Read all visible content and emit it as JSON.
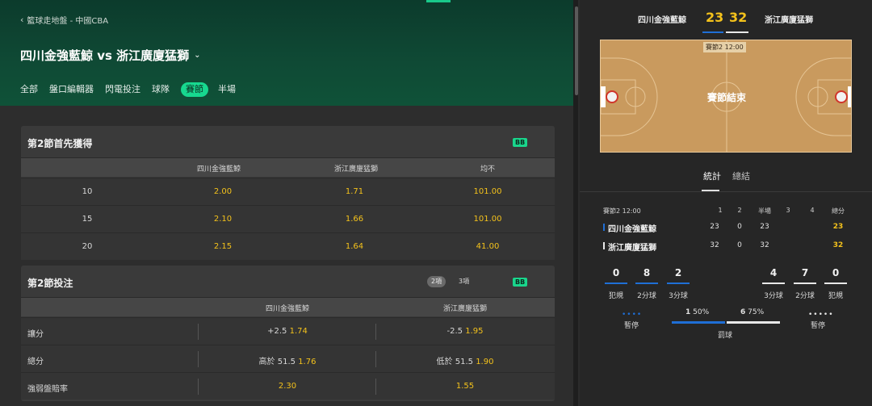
{
  "breadcrumb": "籃球走地盤 - 中國CBA",
  "match_title": "四川金強藍鯨 vs 浙江廣廈猛獅",
  "tabs": [
    {
      "label": "全部"
    },
    {
      "label": "盤口編輯器"
    },
    {
      "label": "閃電投注"
    },
    {
      "label": "球隊"
    },
    {
      "label": "賽節",
      "active": true
    },
    {
      "label": "半場"
    }
  ],
  "badge": "BB",
  "market1": {
    "title": "第2節首先獲得",
    "headers": [
      "四川金強藍鯨",
      "浙江廣廈猛獅",
      "均不"
    ],
    "rows": [
      {
        "label": "10",
        "odds": [
          "2.00",
          "1.71",
          "101.00"
        ]
      },
      {
        "label": "15",
        "odds": [
          "2.10",
          "1.66",
          "101.00"
        ]
      },
      {
        "label": "20",
        "odds": [
          "2.15",
          "1.64",
          "41.00"
        ]
      }
    ]
  },
  "market2": {
    "title": "第2節投注",
    "pill_a": "2項",
    "pill_b": "3項",
    "headers": [
      "四川金強藍鯨",
      "浙江廣廈猛獅"
    ],
    "rows": [
      {
        "label": "讓分",
        "home_line": "+2.5",
        "home_odd": "1.74",
        "away_line": "-2.5",
        "away_odd": "1.95"
      },
      {
        "label": "總分",
        "home_line": "高於 51.5",
        "home_odd": "1.76",
        "away_line": "低於 51.5",
        "away_odd": "1.90"
      },
      {
        "label": "強弱盤賠率",
        "home_line": "",
        "home_odd": "2.30",
        "away_line": "",
        "away_odd": "1.55"
      }
    ]
  },
  "scoreboard": {
    "home": "四川金強藍鯨",
    "away": "浙江廣廈猛獅",
    "home_score": "23",
    "away_score": "32",
    "home_color": "#1f6fd6",
    "away_color": "#e8e8e8"
  },
  "court": {
    "quarter_tag": "賽節2  12:00",
    "status": "賽節結束"
  },
  "right_tabs": [
    "統計",
    "總結"
  ],
  "stats_table": {
    "period": "賽節2  12:00",
    "cols": [
      "1",
      "2",
      "半場",
      "3",
      "4",
      "總分"
    ],
    "home": {
      "name": "四川金強藍鯨",
      "vals": [
        "23",
        "0",
        "23",
        "",
        ""
      ],
      "total": "23"
    },
    "away": {
      "name": "浙江廣廈猛獅",
      "vals": [
        "32",
        "0",
        "32",
        "",
        ""
      ],
      "total": "32"
    }
  },
  "team_stats": {
    "home": [
      {
        "value": "0",
        "label": "犯規"
      },
      {
        "value": "8",
        "label": "2分球"
      },
      {
        "value": "2",
        "label": "3分球"
      }
    ],
    "away": [
      {
        "value": "4",
        "label": "3分球"
      },
      {
        "value": "7",
        "label": "2分球"
      },
      {
        "value": "0",
        "label": "犯規"
      }
    ]
  },
  "timeouts": {
    "label": "暫停",
    "home_dots": "••••",
    "away_dots": "•••••"
  },
  "free_throws": {
    "label": "罰球",
    "home_made": "1",
    "home_pct": "50%",
    "away_made": "6",
    "away_pct": "75%"
  }
}
